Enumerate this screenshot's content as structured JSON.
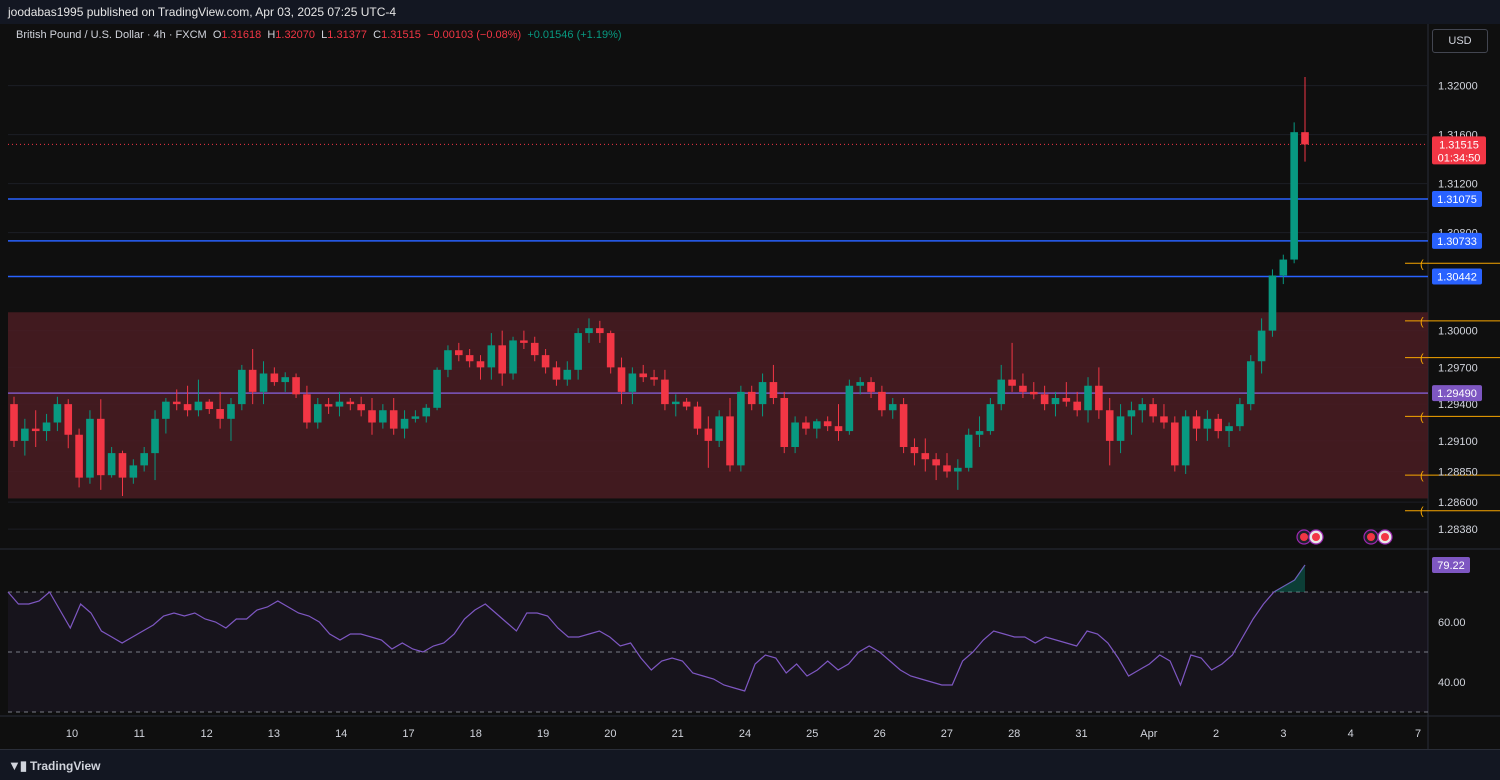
{
  "header": {
    "published": "joodabas1995 published on TradingView.com, Apr 03, 2025 07:25 UTC-4"
  },
  "legend": {
    "symbol": "British Pound / U.S. Dollar · 4h · FXCM",
    "o_label": "O",
    "o": "1.31618",
    "h_label": "H",
    "h": "1.32070",
    "l_label": "L",
    "l": "1.31377",
    "c_label": "C",
    "c": "1.31515",
    "change": "−0.00103 (−0.08%)",
    "volume_change": "+0.01546 (+1.19%)"
  },
  "currency_button": "USD",
  "footer": {
    "logo": "TradingView"
  },
  "colors": {
    "bull": "#089981",
    "bear": "#f23645",
    "hline": "#2962ff",
    "purple_line": "#7e57c2",
    "fib": "#f7a600",
    "zone": "#4a1c22",
    "rsi": "#7e57c2"
  },
  "chart_data": [
    {
      "type": "candlestick",
      "title": "British Pound / U.S. Dollar · 4h · FXCM",
      "ylim": [
        1.2825,
        1.3225
      ],
      "y_ticks": [
        "1.32000",
        "1.31600",
        "1.31200",
        "1.30800",
        "1.30000",
        "1.29700",
        "1.29400",
        "1.29100",
        "1.28850",
        "1.28600",
        "1.28380"
      ],
      "y_tick_values": [
        1.32,
        1.316,
        1.312,
        1.308,
        1.3,
        1.297,
        1.294,
        1.291,
        1.2885,
        1.286,
        1.2838
      ],
      "x_ticks": [
        "10",
        "11",
        "12",
        "13",
        "14",
        "17",
        "18",
        "19",
        "20",
        "21",
        "24",
        "25",
        "26",
        "27",
        "28",
        "31",
        "Apr",
        "2",
        "3",
        "4",
        "7"
      ],
      "x_tick_index": [
        8,
        18,
        28,
        38,
        48,
        58,
        68,
        78,
        88,
        98,
        108,
        118,
        128,
        138,
        148,
        158,
        168,
        178,
        188,
        198,
        208
      ],
      "last_price": "1.31515",
      "countdown": "01:34:50",
      "horizontal_levels": [
        {
          "price": 1.31075,
          "label": "1.31075",
          "kind": "blue"
        },
        {
          "price": 1.30733,
          "label": "1.30733",
          "kind": "blue"
        },
        {
          "price": 1.30442,
          "label": "1.30442",
          "kind": "blue"
        },
        {
          "price": 1.2949,
          "label": "1.29490",
          "kind": "purple"
        }
      ],
      "zone": {
        "from": 1.2863,
        "to": 1.3015
      },
      "fib_levels": [
        1.3055,
        1.3008,
        1.2978,
        1.293,
        1.2882,
        1.2853
      ],
      "fib_start_index": 157,
      "candles": [
        [
          1.294,
          1.2946,
          1.2905,
          1.291
        ],
        [
          1.291,
          1.2928,
          1.2898,
          1.292
        ],
        [
          1.292,
          1.2935,
          1.2905,
          1.2918
        ],
        [
          1.2918,
          1.2932,
          1.291,
          1.2925
        ],
        [
          1.2925,
          1.2946,
          1.2918,
          1.294
        ],
        [
          1.294,
          1.2944,
          1.2904,
          1.2915
        ],
        [
          1.2915,
          1.292,
          1.2872,
          1.288
        ],
        [
          1.288,
          1.2935,
          1.2875,
          1.2928
        ],
        [
          1.2928,
          1.2944,
          1.287,
          1.2882
        ],
        [
          1.2882,
          1.2905,
          1.288,
          1.29
        ],
        [
          1.29,
          1.2902,
          1.2865,
          1.288
        ],
        [
          1.288,
          1.2895,
          1.2875,
          1.289
        ],
        [
          1.289,
          1.2905,
          1.2885,
          1.29
        ],
        [
          1.29,
          1.2935,
          1.2878,
          1.2928
        ],
        [
          1.2928,
          1.2945,
          1.2916,
          1.2942
        ],
        [
          1.2942,
          1.2952,
          1.2935,
          1.294
        ],
        [
          1.294,
          1.2955,
          1.293,
          1.2935
        ],
        [
          1.2935,
          1.296,
          1.293,
          1.2942
        ],
        [
          1.2942,
          1.2944,
          1.2932,
          1.2936
        ],
        [
          1.2936,
          1.295,
          1.292,
          1.2928
        ],
        [
          1.2928,
          1.2945,
          1.291,
          1.294
        ],
        [
          1.294,
          1.2972,
          1.2935,
          1.2968
        ],
        [
          1.2968,
          1.2985,
          1.294,
          1.295
        ],
        [
          1.295,
          1.2975,
          1.294,
          1.2965
        ],
        [
          1.2965,
          1.297,
          1.2955,
          1.2958
        ],
        [
          1.2958,
          1.2966,
          1.295,
          1.2962
        ],
        [
          1.2962,
          1.2965,
          1.2945,
          1.2948
        ],
        [
          1.2948,
          1.2955,
          1.292,
          1.2925
        ],
        [
          1.2925,
          1.2945,
          1.292,
          1.294
        ],
        [
          1.294,
          1.2945,
          1.2932,
          1.2938
        ],
        [
          1.2938,
          1.295,
          1.293,
          1.2942
        ],
        [
          1.2942,
          1.2945,
          1.2935,
          1.294
        ],
        [
          1.294,
          1.2946,
          1.293,
          1.2935
        ],
        [
          1.2935,
          1.2945,
          1.2915,
          1.2925
        ],
        [
          1.2925,
          1.294,
          1.292,
          1.2935
        ],
        [
          1.2935,
          1.2945,
          1.2915,
          1.292
        ],
        [
          1.292,
          1.2935,
          1.2912,
          1.2928
        ],
        [
          1.2928,
          1.2935,
          1.2925,
          1.293
        ],
        [
          1.293,
          1.294,
          1.2925,
          1.2937
        ],
        [
          1.2937,
          1.297,
          1.2935,
          1.2968
        ],
        [
          1.2968,
          1.2988,
          1.2962,
          1.2984
        ],
        [
          1.2984,
          1.299,
          1.2975,
          1.298
        ],
        [
          1.298,
          1.2985,
          1.297,
          1.2975
        ],
        [
          1.2975,
          1.298,
          1.296,
          1.297
        ],
        [
          1.297,
          1.2998,
          1.296,
          1.2988
        ],
        [
          1.2988,
          1.3,
          1.2955,
          1.2965
        ],
        [
          1.2965,
          1.2995,
          1.296,
          1.2992
        ],
        [
          1.2992,
          1.3,
          1.2985,
          1.299
        ],
        [
          1.299,
          1.2995,
          1.2975,
          1.298
        ],
        [
          1.298,
          1.2985,
          1.2965,
          1.297
        ],
        [
          1.297,
          1.2975,
          1.2955,
          1.296
        ],
        [
          1.296,
          1.2975,
          1.2955,
          1.2968
        ],
        [
          1.2968,
          1.3002,
          1.296,
          1.2998
        ],
        [
          1.2998,
          1.301,
          1.299,
          1.3002
        ],
        [
          1.3002,
          1.3008,
          1.299,
          1.2998
        ],
        [
          1.2998,
          1.3,
          1.2965,
          1.297
        ],
        [
          1.297,
          1.2978,
          1.294,
          1.295
        ],
        [
          1.295,
          1.297,
          1.294,
          1.2965
        ],
        [
          1.2965,
          1.2972,
          1.2958,
          1.2962
        ],
        [
          1.2962,
          1.2968,
          1.2955,
          1.296
        ],
        [
          1.296,
          1.2968,
          1.2935,
          1.294
        ],
        [
          1.294,
          1.2948,
          1.293,
          1.2942
        ],
        [
          1.2942,
          1.2945,
          1.2935,
          1.2938
        ],
        [
          1.2938,
          1.2942,
          1.2915,
          1.292
        ],
        [
          1.292,
          1.293,
          1.2888,
          1.291
        ],
        [
          1.291,
          1.2935,
          1.2905,
          1.293
        ],
        [
          1.293,
          1.2945,
          1.2885,
          1.289
        ],
        [
          1.289,
          1.2955,
          1.2885,
          1.295
        ],
        [
          1.295,
          1.2955,
          1.2935,
          1.294
        ],
        [
          1.294,
          1.2965,
          1.293,
          1.2958
        ],
        [
          1.2958,
          1.2972,
          1.294,
          1.2945
        ],
        [
          1.2945,
          1.295,
          1.29,
          1.2905
        ]
      ],
      "candles_b": [
        [
          1.2905,
          1.293,
          1.29,
          1.2925
        ],
        [
          1.2925,
          1.293,
          1.2915,
          1.292
        ],
        [
          1.292,
          1.2928,
          1.2912,
          1.2926
        ],
        [
          1.2926,
          1.293,
          1.2918,
          1.2922
        ],
        [
          1.2922,
          1.294,
          1.291,
          1.2918
        ],
        [
          1.2918,
          1.296,
          1.2915,
          1.2955
        ],
        [
          1.2955,
          1.2962,
          1.2948,
          1.2958
        ],
        [
          1.2958,
          1.2962,
          1.2945,
          1.295
        ],
        [
          1.295,
          1.2955,
          1.293,
          1.2935
        ],
        [
          1.2935,
          1.2945,
          1.2928,
          1.294
        ],
        [
          1.294,
          1.2945,
          1.29,
          1.2905
        ],
        [
          1.2905,
          1.2912,
          1.289,
          1.29
        ],
        [
          1.29,
          1.2912,
          1.2885,
          1.2895
        ],
        [
          1.2895,
          1.29,
          1.2878,
          1.289
        ],
        [
          1.289,
          1.29,
          1.288,
          1.2885
        ],
        [
          1.2885,
          1.2895,
          1.287,
          1.2888
        ],
        [
          1.2888,
          1.292,
          1.2885,
          1.2915
        ],
        [
          1.2915,
          1.293,
          1.2905,
          1.2918
        ],
        [
          1.2918,
          1.2945,
          1.2915,
          1.294
        ],
        [
          1.294,
          1.2972,
          1.2935,
          1.296
        ],
        [
          1.296,
          1.299,
          1.295,
          1.2955
        ],
        [
          1.2955,
          1.2965,
          1.2945,
          1.295
        ],
        [
          1.295,
          1.2958,
          1.2944,
          1.2948
        ],
        [
          1.2948,
          1.2955,
          1.2935,
          1.294
        ],
        [
          1.294,
          1.295,
          1.293,
          1.2945
        ],
        [
          1.2945,
          1.2958,
          1.2938,
          1.2942
        ],
        [
          1.2942,
          1.295,
          1.293,
          1.2935
        ],
        [
          1.2935,
          1.2962,
          1.2925,
          1.2955
        ],
        [
          1.2955,
          1.297,
          1.2928,
          1.2935
        ],
        [
          1.2935,
          1.2945,
          1.289,
          1.291
        ],
        [
          1.291,
          1.294,
          1.29,
          1.293
        ],
        [
          1.293,
          1.2942,
          1.2915,
          1.2935
        ],
        [
          1.2935,
          1.2945,
          1.2925,
          1.294
        ],
        [
          1.294,
          1.2945,
          1.2925,
          1.293
        ],
        [
          1.293,
          1.294,
          1.292,
          1.2925
        ],
        [
          1.2925,
          1.293,
          1.2885,
          1.289
        ],
        [
          1.289,
          1.2935,
          1.2883,
          1.293
        ],
        [
          1.293,
          1.2935,
          1.291,
          1.292
        ],
        [
          1.292,
          1.2935,
          1.291,
          1.2928
        ],
        [
          1.2928,
          1.2932,
          1.2912,
          1.2918
        ],
        [
          1.2918,
          1.2925,
          1.2905,
          1.2922
        ],
        [
          1.2922,
          1.2945,
          1.2918,
          1.294
        ],
        [
          1.294,
          1.298,
          1.2935,
          1.2975
        ],
        [
          1.2975,
          1.301,
          1.2965,
          1.3
        ],
        [
          1.3,
          1.305,
          1.2995,
          1.3045
        ],
        [
          1.3045,
          1.3062,
          1.3038,
          1.3058
        ],
        [
          1.3058,
          1.317,
          1.3055,
          1.3162
        ],
        [
          1.3162,
          1.3207,
          1.3138,
          1.3152
        ]
      ]
    },
    {
      "type": "line",
      "title": "RSI",
      "last_value": "79.22",
      "y_ticks": [
        "60.00",
        "40.00"
      ],
      "ylim": [
        30,
        80
      ],
      "bands": [
        70,
        50,
        30
      ],
      "values": [
        70,
        66,
        66,
        67,
        70,
        64,
        58,
        66,
        63,
        57,
        55,
        53,
        55,
        57,
        59,
        62,
        63,
        62,
        63,
        61,
        60,
        58,
        61,
        61,
        64,
        65,
        67,
        65,
        63,
        62,
        60,
        56,
        54,
        56,
        56,
        55,
        54,
        51,
        53,
        51,
        50,
        52,
        53,
        56,
        61,
        64,
        66,
        63,
        60,
        57,
        63,
        63,
        62,
        58,
        55,
        55,
        56,
        57,
        55,
        52,
        53,
        48,
        44,
        47,
        48,
        47,
        43,
        42,
        41,
        39,
        38,
        37,
        46,
        49,
        48,
        43,
        46,
        42,
        44,
        47,
        44,
        46,
        50,
        52,
        50,
        47,
        44,
        42,
        41,
        40,
        39,
        39,
        47,
        50,
        54,
        57,
        56,
        55,
        55,
        53,
        55,
        54,
        53,
        52,
        57,
        56,
        53,
        48,
        42,
        44,
        46,
        49,
        47,
        39,
        49,
        48,
        44,
        46,
        49,
        55,
        61,
        66,
        70,
        72,
        74,
        79
      ]
    }
  ]
}
